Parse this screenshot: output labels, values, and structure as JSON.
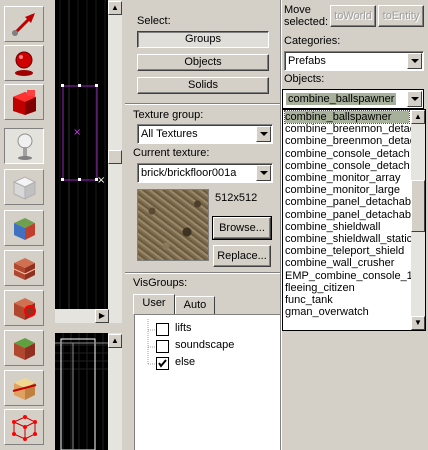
{
  "toolbar": {
    "tools": [
      {
        "icon": "selection-arrow-icon"
      },
      {
        "icon": "magnify-icon"
      },
      {
        "icon": "camera-cube-icon"
      },
      {
        "icon": "entity-tool-icon"
      },
      {
        "icon": "block-tool-icon"
      },
      {
        "icon": "texture-application-icon"
      },
      {
        "icon": "apply-texture-icon"
      },
      {
        "icon": "decal-tool-icon"
      },
      {
        "icon": "overlay-tool-icon"
      },
      {
        "icon": "clipping-tool-icon"
      },
      {
        "icon": "vertex-tool-icon"
      }
    ]
  },
  "select": {
    "label": "Select:",
    "groups": "Groups",
    "objects": "Objects",
    "solids": "Solids"
  },
  "texture": {
    "group_label": "Texture group:",
    "group_value": "All Textures",
    "current_label": "Current texture:",
    "current_value": "brick/brickfloor001a",
    "size": "512x512",
    "browse": "Browse...",
    "replace": "Replace..."
  },
  "visgroups": {
    "label": "VisGroups:",
    "tab_user": "User",
    "tab_auto": "Auto",
    "items": [
      {
        "label": "lifts",
        "checked": false
      },
      {
        "label": "soundscape",
        "checked": false
      },
      {
        "label": "else",
        "checked": true
      }
    ]
  },
  "move": {
    "label_line1": "Move",
    "label_line2": "selected:",
    "to_world": "toWorld",
    "to_entity": "toEntity"
  },
  "categories": {
    "label": "Categories:",
    "value": "Prefabs"
  },
  "objects": {
    "label": "Objects:",
    "value": "combine_ballspawner",
    "list": [
      "combine_ballspawner",
      "combine_breenmon_detac",
      "combine_breenmon_detac",
      "combine_console_detach",
      "combine_console_detach",
      "combine_monitor_array",
      "combine_monitor_large",
      "combine_panel_detachab",
      "combine_panel_detachab",
      "combine_shieldwall",
      "combine_shieldwall_static",
      "combine_teleport_shield",
      "combine_wall_crusher",
      "EMP_combine_console_1",
      "fleeing_citizen",
      "func_tank",
      "gman_overwatch"
    ],
    "selected_index": 0,
    "scroll_position": 0.4
  }
}
